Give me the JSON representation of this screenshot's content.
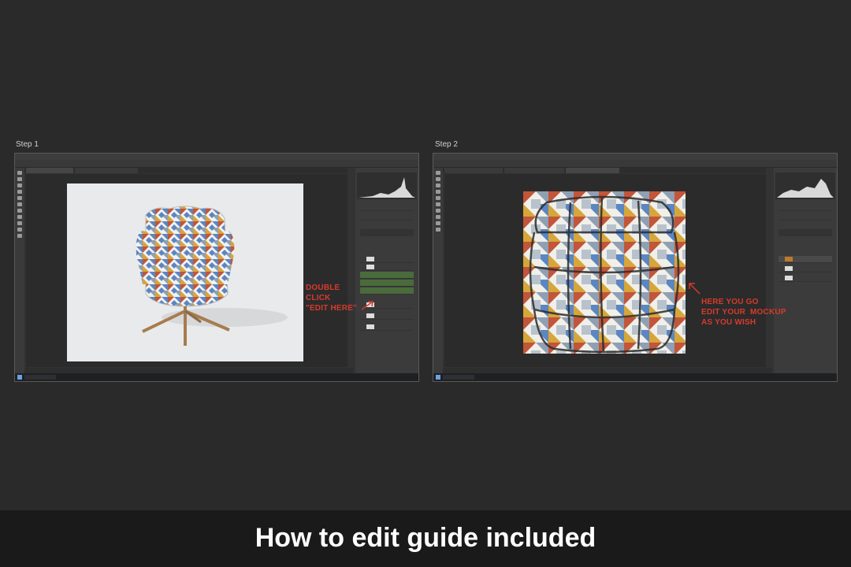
{
  "steps": [
    {
      "label": "Step 1",
      "annotation": "DOUBLE\nCLICK\n\"EDIT HERE\""
    },
    {
      "label": "Step 2",
      "annotation": "HERE YOU GO\nEDIT YOUR  MOCKUP\nAS YOU WISH"
    }
  ],
  "caption": "How to edit guide included",
  "colors": {
    "annotation": "#d63b2a",
    "background": "#2a2a2b",
    "pattern_red": "#c2553a",
    "pattern_blue": "#5b86c2",
    "pattern_yellow": "#d6a63a",
    "pattern_grey": "#8fa0b3"
  },
  "icons": [
    "chair-mockup-image",
    "pattern-grid-image",
    "arrow-icon",
    "search-icon",
    "windows-start-icon"
  ]
}
